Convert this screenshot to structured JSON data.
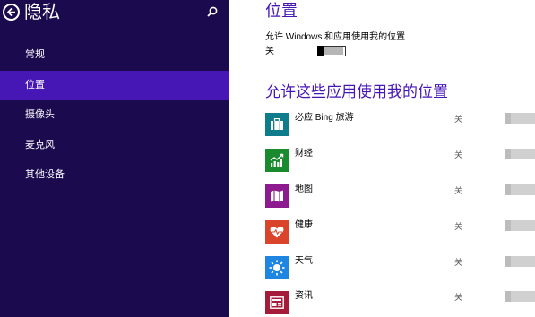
{
  "header": {
    "title": "隐私",
    "back_icon": "back-arrow-icon",
    "search_icon": "search-icon"
  },
  "nav": {
    "items": [
      {
        "label": "常规",
        "selected": false
      },
      {
        "label": "位置",
        "selected": true
      },
      {
        "label": "摄像头",
        "selected": false
      },
      {
        "label": "麦克风",
        "selected": false
      },
      {
        "label": "其他设备",
        "selected": false
      }
    ]
  },
  "main": {
    "title": "位置",
    "location_setting": {
      "label": "允许 Windows 和应用使用我的位置",
      "state": "关"
    },
    "apps_section_title": "允许这些应用使用我的位置",
    "apps": [
      {
        "name": "必应 Bing 旅游",
        "state": "关",
        "tile_color": "#0f7c8c",
        "icon": "suitcase-icon"
      },
      {
        "name": "财经",
        "state": "关",
        "tile_color": "#1a8a2e",
        "icon": "finance-chart-icon"
      },
      {
        "name": "地图",
        "state": "关",
        "tile_color": "#8d1a8f",
        "icon": "map-icon"
      },
      {
        "name": "健康",
        "state": "关",
        "tile_color": "#d9442b",
        "icon": "heart-icon"
      },
      {
        "name": "天气",
        "state": "关",
        "tile_color": "#1e86e0",
        "icon": "sun-icon"
      },
      {
        "name": "资讯",
        "state": "关",
        "tile_color": "#a51c3a",
        "icon": "news-icon"
      }
    ]
  },
  "colors": {
    "left_pane_bg": "#1c0a4f",
    "selected_bg": "#4617b4",
    "accent_text": "#4617b4"
  }
}
